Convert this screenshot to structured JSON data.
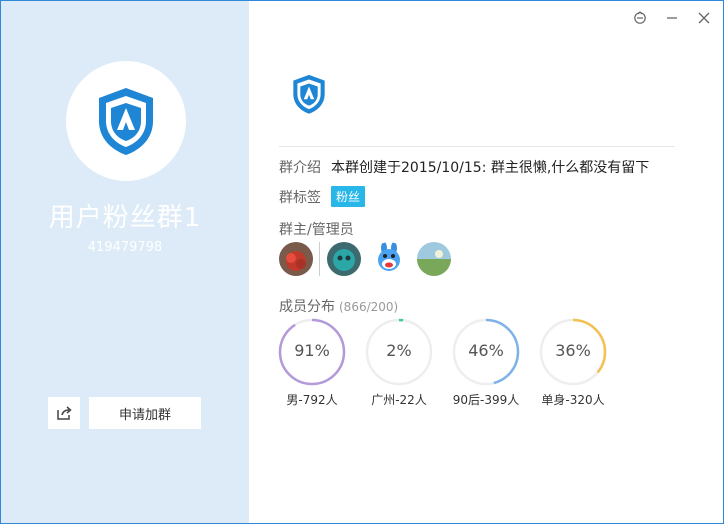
{
  "window": {
    "controls": [
      "skin-icon",
      "minimize-icon",
      "close-icon"
    ]
  },
  "sidebar": {
    "group_name": "用户粉丝群1",
    "group_id": "419479798",
    "share_icon": "share-icon",
    "join_label": "申请加群"
  },
  "info": {
    "intro_label": "群介绍",
    "intro_text": "本群创建于2015/10/15: 群主很懒,什么都没有留下",
    "tags_label": "群标签",
    "tag": "粉丝",
    "admins_label": "群主/管理员"
  },
  "stats": {
    "title": "成员分布",
    "count": "(866/200)",
    "items": [
      {
        "percent": "91%",
        "value": 91,
        "label": "男-792人",
        "color": "#b49ad8"
      },
      {
        "percent": "2%",
        "value": 2,
        "label": "广州-22人",
        "color": "#3fcc8a"
      },
      {
        "percent": "46%",
        "value": 46,
        "label": "90后-399人",
        "color": "#7fb3e8"
      },
      {
        "percent": "36%",
        "value": 36,
        "label": "单身-320人",
        "color": "#f3c052"
      }
    ]
  },
  "colors": {
    "accent": "#2f89d8",
    "sidebar_bg": "#dcebf7",
    "tag_bg": "#29b6e8"
  }
}
